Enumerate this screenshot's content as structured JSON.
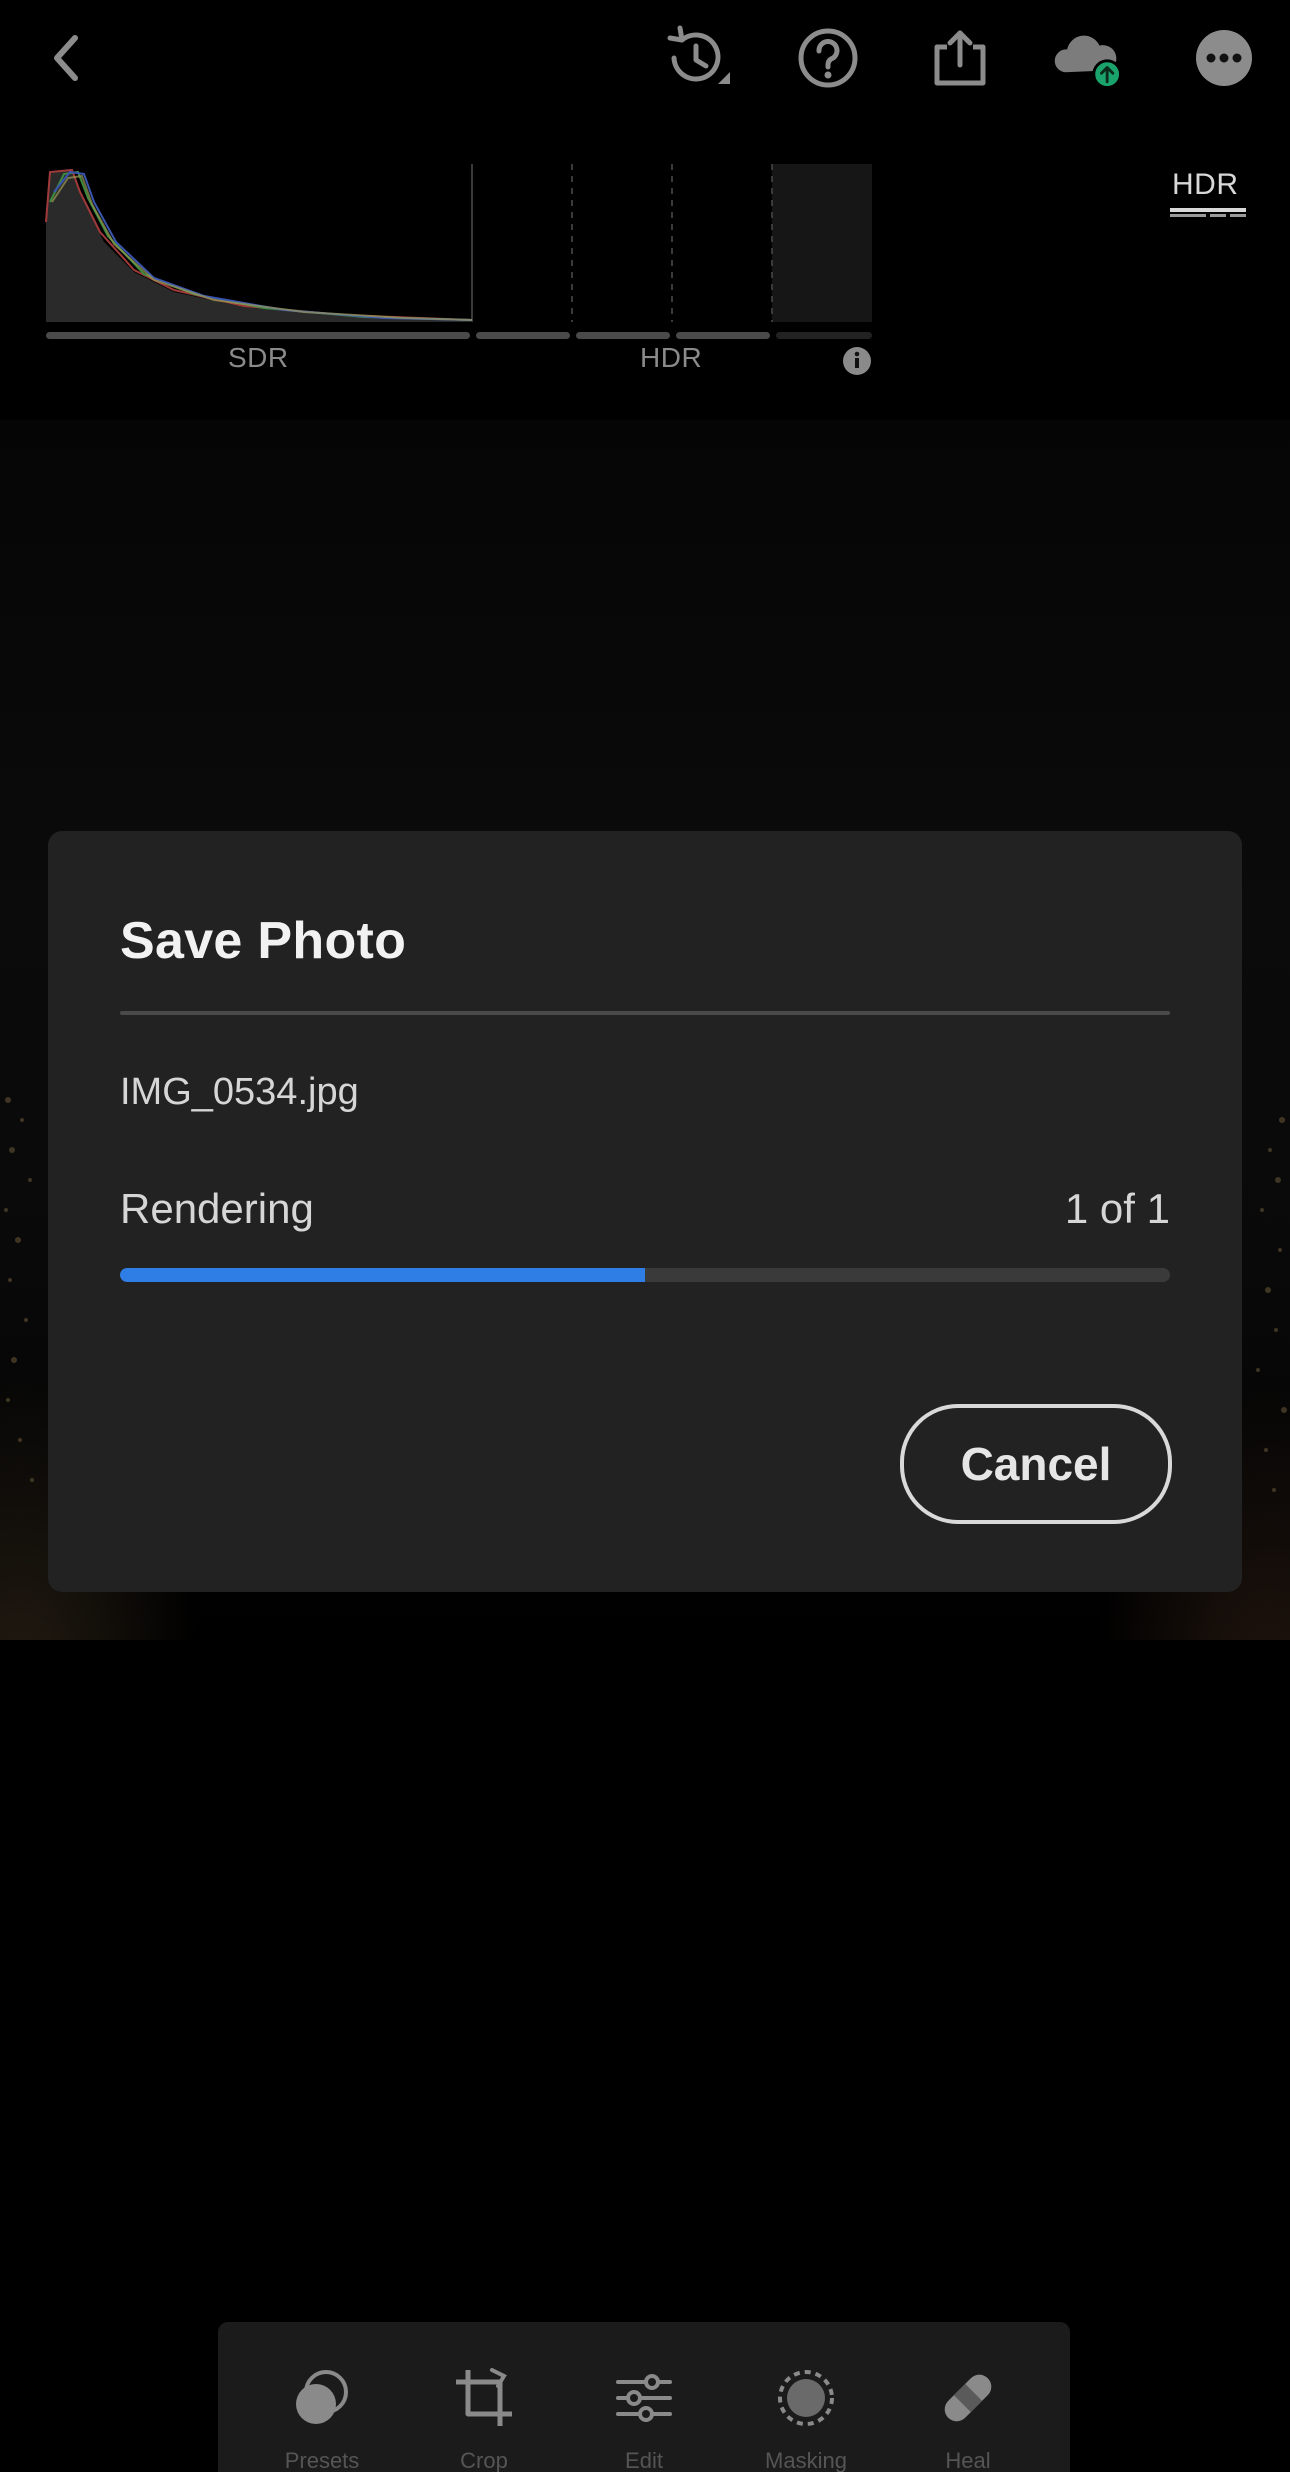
{
  "topbar": {
    "icons": [
      "back-chevron-icon",
      "history-icon",
      "help-icon",
      "share-icon",
      "cloud-sync-icon",
      "more-icon"
    ],
    "sync_status_color": "#1aa36a"
  },
  "histogram": {
    "sdr_label": "SDR",
    "hdr_label": "HDR",
    "hdr_toggle_label": "HDR",
    "info_icon": "info-icon"
  },
  "dialog": {
    "title": "Save Photo",
    "filename": "IMG_0534.jpg",
    "status": "Rendering",
    "count": "1 of 1",
    "progress_fraction": 0.5,
    "progress_color": "#2f7ee6",
    "cancel_label": "Cancel"
  },
  "bottom_toolbar": {
    "tools": [
      {
        "icon": "presets-icon",
        "label": "Presets"
      },
      {
        "icon": "crop-icon",
        "label": "Crop"
      },
      {
        "icon": "edit-sliders-icon",
        "label": "Edit"
      },
      {
        "icon": "masking-icon",
        "label": "Masking"
      },
      {
        "icon": "heal-bandage-icon",
        "label": "Heal"
      }
    ]
  }
}
